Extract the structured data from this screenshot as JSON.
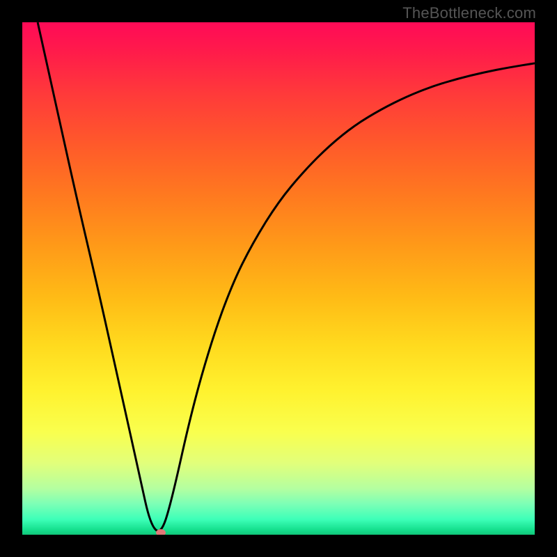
{
  "watermark": "TheBottleneck.com",
  "colors": {
    "frame": "#000000",
    "curve": "#000000",
    "min_marker": "#e07878"
  },
  "chart_data": {
    "type": "line",
    "title": "",
    "xlabel": "",
    "ylabel": "",
    "xlim": [
      0,
      100
    ],
    "ylim": [
      0,
      100
    ],
    "grid": false,
    "legend": false,
    "series": [
      {
        "name": "bottleneck-curve",
        "x": [
          3,
          7,
          11,
          15,
          19,
          23,
          25,
          27,
          29,
          33,
          37,
          41,
          45,
          50,
          55,
          60,
          65,
          70,
          75,
          80,
          85,
          90,
          95,
          100
        ],
        "y": [
          100,
          82,
          64,
          47,
          29,
          11,
          2,
          0,
          6,
          24,
          38,
          49,
          57,
          65,
          71,
          76,
          80,
          83,
          85.5,
          87.5,
          89,
          90.2,
          91.2,
          92
        ]
      },
      {
        "name": "min-marker",
        "x": [
          27
        ],
        "y": [
          0
        ]
      }
    ]
  }
}
